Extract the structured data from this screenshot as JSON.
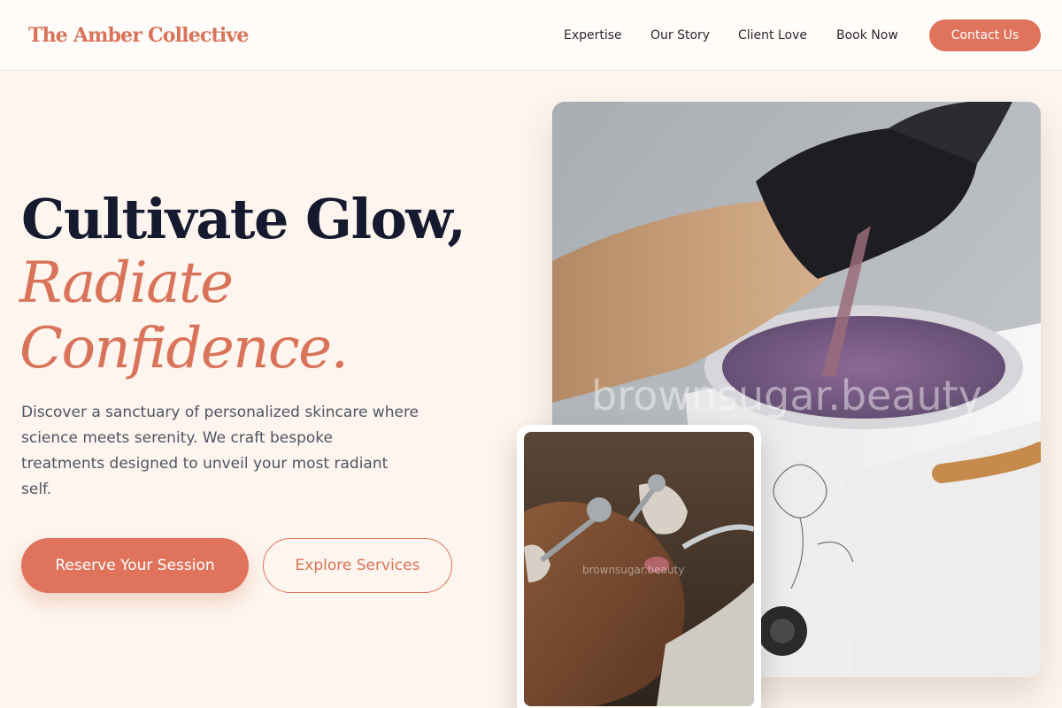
{
  "brand": {
    "name": "The Amber Collective",
    "accent_color": "#df735b",
    "ink_color": "#151a2e",
    "background_color": "#fdf5ee"
  },
  "nav": {
    "links": [
      {
        "label": "Expertise"
      },
      {
        "label": "Our Story"
      },
      {
        "label": "Client Love"
      },
      {
        "label": "Book Now"
      }
    ],
    "contact_label": "Contact Us"
  },
  "hero": {
    "headline_line1": "Cultivate Glow,",
    "headline_line2": "Radiate",
    "headline_line3": "Confidence.",
    "description": "Discover a sanctuary of personalized skincare where science meets serenity. We craft bespoke treatments designed to unveil your most radiant self.",
    "primary_cta": "Reserve Your Session",
    "secondary_cta": "Explore Services"
  },
  "images": {
    "main_photo_alt": "wax-warmer-photo",
    "main_watermark": "brownsugar.beauty",
    "inset_photo_alt": "facial-treatment-photo",
    "inset_watermark": "brownsugar.beauty"
  }
}
